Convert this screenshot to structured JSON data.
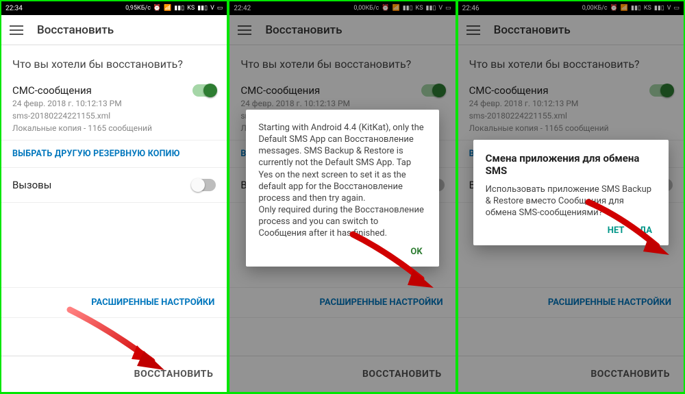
{
  "status": {
    "time1": "22:34",
    "time2": "22:42",
    "time3": "22:46",
    "net1": "0,95КБ/с",
    "net2": "0,00КБ/с",
    "net3": "0,00КБ/с",
    "carrier": "KS",
    "sig": "V"
  },
  "appbar": {
    "title": "Восстановить"
  },
  "page": {
    "heading": "Что вы хотели бы восстановить?",
    "sms_title": "СМС-сообщения",
    "sms_date": "24 февр. 2018 г. 10:12:13 PM",
    "sms_file": "sms-20180224221155.xml",
    "sms_count": "Локальные копия - 1165 сообщений",
    "choose_backup": "ВЫБРАТЬ ДРУГУЮ РЕЗЕРВНУЮ КОПИЮ",
    "calls_title": "Вызовы",
    "advanced": "РАСШИРЕННЫЕ НАСТРОЙКИ",
    "restore": "ВОССТАНОВИТЬ"
  },
  "dialog1": {
    "body": "Starting with Android 4.4 (KitKat), only the Default SMS App can Восстановление messages. SMS Backup & Restore is currently not the Default SMS App. Tap Yes on the next screen to set it as the default app for the Восстановление process and then try again.\nOnly required during the Восстановление process and you can switch to Сообщения after it has finished.",
    "ok": "OK"
  },
  "dialog2": {
    "title": "Смена приложения для обмена SMS",
    "body": "Использовать приложение SMS Backup & Restore вместо Сообщения для обмена SMS-сообщениями?",
    "no": "НЕТ",
    "yes": "ДА"
  }
}
